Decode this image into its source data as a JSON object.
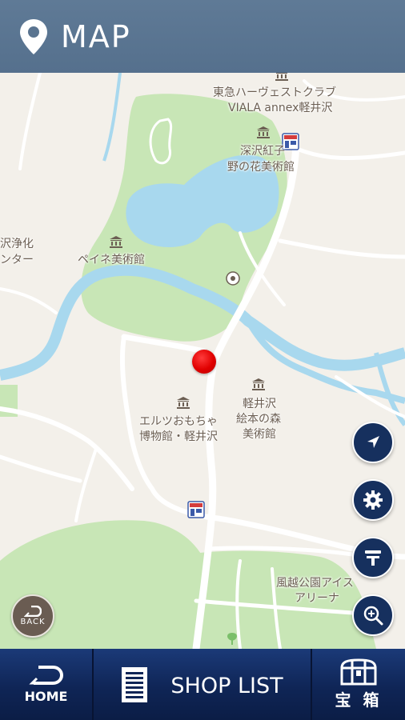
{
  "header": {
    "title": "MAP"
  },
  "map": {
    "labels": {
      "tokyu_harvest": "東急ハーヴェストクラブ",
      "viala_annex": "VIALA annex軽井沢",
      "fukasawa": "深沢紅子",
      "nonohana": "野の花美術館",
      "left_jouka": "沢浄化",
      "left_center": "ンター",
      "peynet": "ペイネ美術館",
      "ertz_1": "エルツおもちゃ",
      "ertz_2": "博物館・軽井沢",
      "ehon_1": "軽井沢",
      "ehon_2": "絵本の森",
      "ehon_3": "美術館",
      "kazakoshi_1": "風越公園アイス",
      "kazakoshi_2": "アリーナ"
    }
  },
  "controls": {
    "back_label": "BACK",
    "icons": [
      "navigation-arrow-icon",
      "settings-gear-icon",
      "filter-icon",
      "zoom-in-icon"
    ]
  },
  "footer": {
    "home_label": "HOME",
    "shop_list_label": "SHOP LIST",
    "treasure_label": "宝 箱"
  }
}
